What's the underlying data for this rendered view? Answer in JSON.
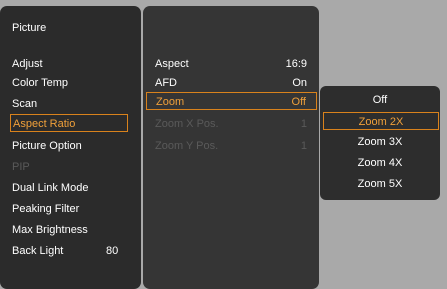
{
  "main_menu": {
    "title": "Picture",
    "items": [
      {
        "label": "Adjust"
      },
      {
        "label": "Color Temp"
      },
      {
        "label": "Scan"
      },
      {
        "label": "Aspect Ratio"
      },
      {
        "label": "Picture Option"
      },
      {
        "label": "PIP"
      },
      {
        "label": "Dual Link Mode"
      },
      {
        "label": "Peaking Filter"
      },
      {
        "label": "Max Brightness"
      },
      {
        "label": "Back Light",
        "value": "80"
      }
    ]
  },
  "aspect_menu": {
    "items": [
      {
        "label": "Aspect",
        "value": "16:9"
      },
      {
        "label": "AFD",
        "value": "On"
      },
      {
        "label": "Zoom",
        "value": "Off"
      },
      {
        "label": "Zoom X Pos.",
        "value": "1"
      },
      {
        "label": "Zoom Y Pos.",
        "value": "1"
      }
    ]
  },
  "zoom_options": [
    "Off",
    "Zoom 2X",
    "Zoom 3X",
    "Zoom 4X",
    "Zoom 5X"
  ],
  "colors": {
    "accent": "#d9821c",
    "panel": "#2b2b2b",
    "background": "#a9a9a9"
  }
}
